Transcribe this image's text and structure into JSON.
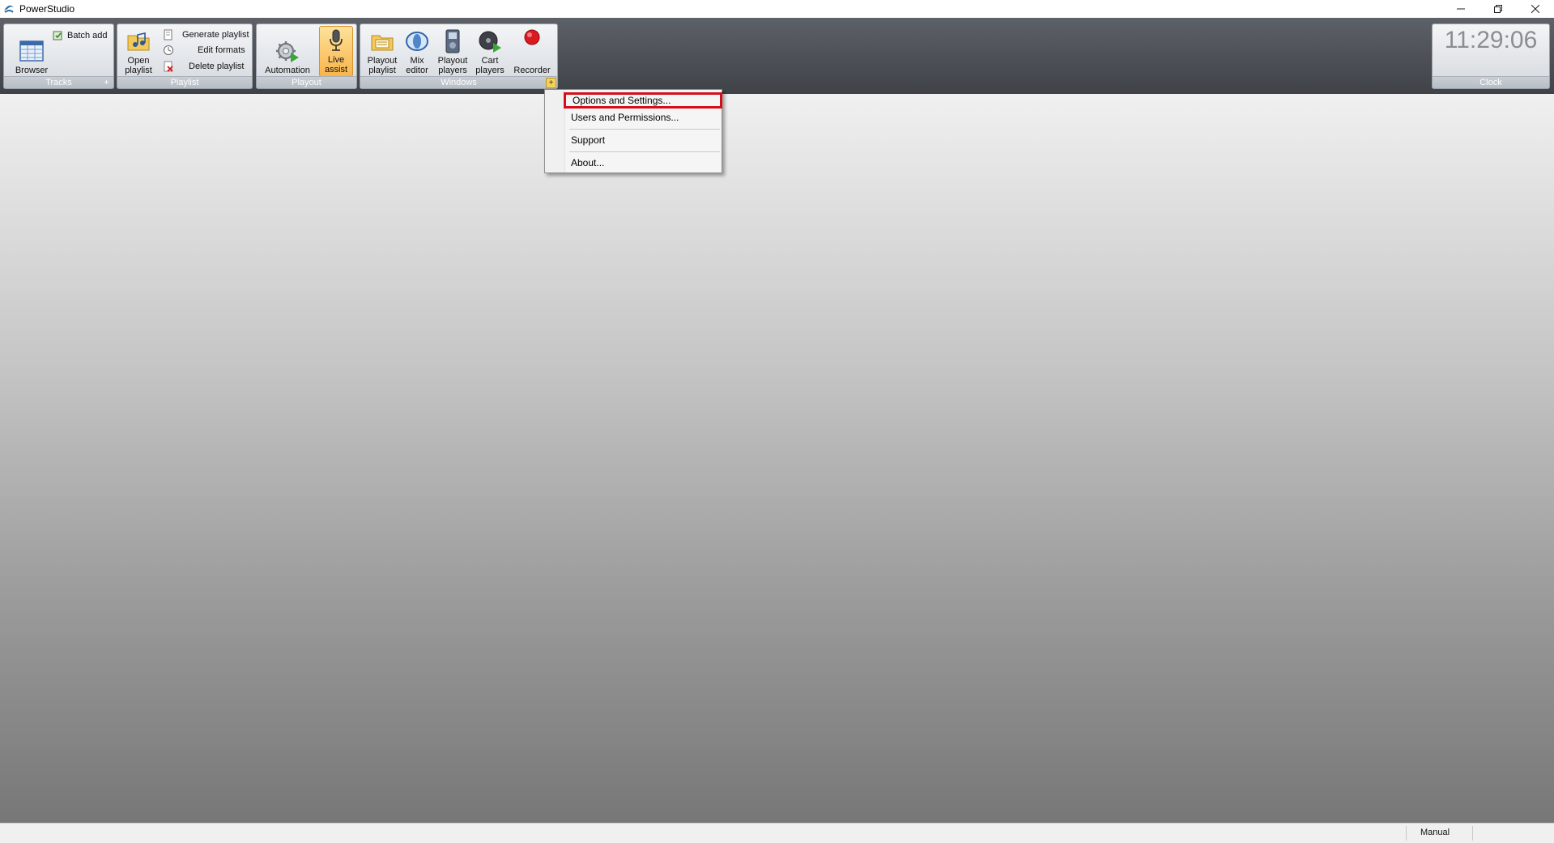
{
  "window": {
    "title": "PowerStudio",
    "controls": [
      "minimize",
      "restore",
      "close"
    ]
  },
  "ribbon": {
    "groups": [
      {
        "label": "Tracks",
        "buttons": [
          {
            "label": "Browser",
            "icon": "grid-icon"
          },
          {
            "label": "Batch add",
            "icon": "batch-add-icon"
          }
        ],
        "launcher": "+"
      },
      {
        "label": "Playlist",
        "buttons": [
          {
            "label": "Open playlist",
            "icon": "open-playlist-icon"
          },
          {
            "label": "Generate playlist",
            "icon": "generate-playlist-icon"
          },
          {
            "label": "Edit formats",
            "icon": "edit-formats-icon"
          },
          {
            "label": "Delete playlist",
            "icon": "delete-icon"
          }
        ]
      },
      {
        "label": "Playout",
        "buttons": [
          {
            "label": "Automation",
            "icon": "gear-play-icon"
          },
          {
            "label": "Live assist",
            "icon": "microphone-icon",
            "active": true
          }
        ]
      },
      {
        "label": "Windows",
        "buttons": [
          {
            "label": "Playout playlist",
            "icon": "playout-playlist-icon"
          },
          {
            "label": "Mix editor",
            "icon": "mix-editor-icon"
          },
          {
            "label": "Playout players",
            "icon": "playout-players-icon"
          },
          {
            "label": "Cart players",
            "icon": "cart-players-icon"
          },
          {
            "label": "Recorder",
            "icon": "record-icon"
          }
        ],
        "launcher": "+"
      }
    ],
    "clock": {
      "time": "11:29:06",
      "label": "Clock"
    }
  },
  "menu": {
    "items": [
      {
        "label": "Options and Settings...",
        "highlighted": true
      },
      {
        "label": "Users and Permissions..."
      },
      {
        "label": "Support"
      },
      {
        "label": "About..."
      }
    ]
  },
  "status": {
    "mode": "Manual"
  },
  "colors": {
    "highlight_border": "#d40f1a",
    "active_button": "#f9b44a",
    "record_red": "#d81b20"
  }
}
